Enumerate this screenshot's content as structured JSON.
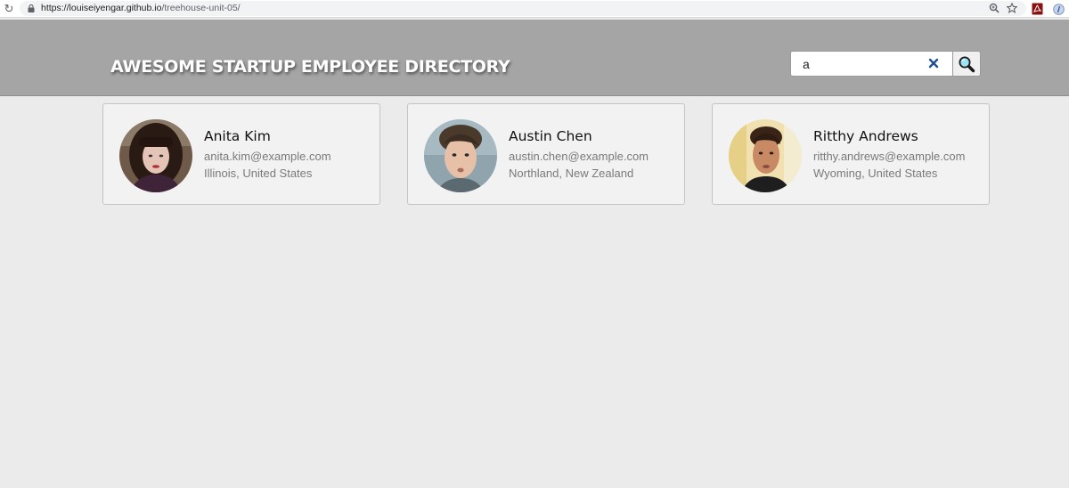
{
  "browser": {
    "url_host": "https://louiseiyengar.github.io",
    "url_path": "/treehouse-unit-05/",
    "icons": [
      "reload-icon",
      "lock-icon",
      "zoom-icon",
      "star-icon",
      "pdf-extension-icon",
      "extension-icon"
    ]
  },
  "header": {
    "title": "AWESOME STARTUP EMPLOYEE DIRECTORY"
  },
  "search": {
    "value": "a",
    "clear_icon": "close-icon",
    "button_icon": "search-icon"
  },
  "colors": {
    "header_bg": "#a5a5a5",
    "page_bg": "#ebebeb",
    "card_bg": "#f2f2f2",
    "clear_icon": "#1f4f8f"
  },
  "employees": [
    {
      "name": "Anita Kim",
      "email": "anita.kim@example.com",
      "location": "Illinois, United States"
    },
    {
      "name": "Austin Chen",
      "email": "austin.chen@example.com",
      "location": "Northland, New Zealand"
    },
    {
      "name": "Ritthy Andrews",
      "email": "ritthy.andrews@example.com",
      "location": "Wyoming, United States"
    }
  ]
}
